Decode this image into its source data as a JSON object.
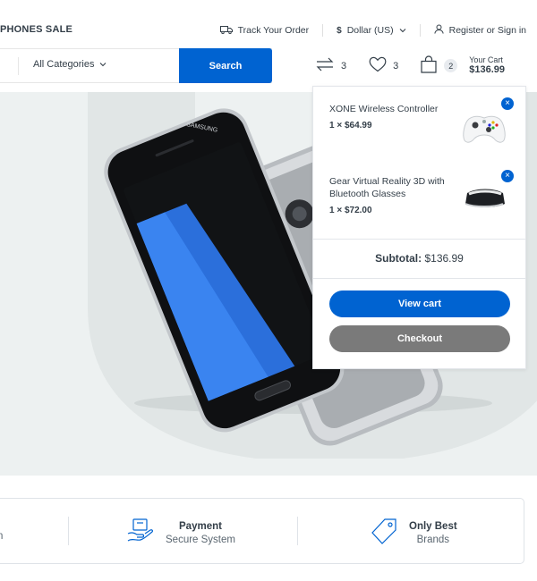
{
  "topbar": {
    "promo": "PHONES SALE",
    "track_order": "Track Your Order",
    "currency": "Dollar (US)",
    "account": "Register or Sign in"
  },
  "search": {
    "category": "All Categories",
    "button": "Search"
  },
  "header": {
    "compare_count": "3",
    "wishlist_count": "3",
    "cart_count": "2",
    "cart_label": "Your Cart",
    "cart_total": "$136.99"
  },
  "cart_dropdown": {
    "items": [
      {
        "name": "XONE Wireless Controller",
        "price": "1 × $64.99"
      },
      {
        "name": "Gear Virtual Reality 3D with Bluetooth Glasses",
        "price": "1 × $72.00"
      }
    ],
    "subtotal_label": "Subtotal:",
    "subtotal_value": "$136.99",
    "view_cart": "View cart",
    "checkout": "Checkout"
  },
  "hero": {
    "phone_brand": "SAMSUNG"
  },
  "features": [
    {
      "title": "",
      "subtitle": "n"
    },
    {
      "title": "Payment",
      "subtitle": "Secure System"
    },
    {
      "title": "Only Best",
      "subtitle": "Brands"
    }
  ],
  "colors": {
    "accent": "#0063d1",
    "text": "#333e48",
    "hero_bg": "#edf1f1",
    "checkout_bg": "#7a7a7a"
  }
}
